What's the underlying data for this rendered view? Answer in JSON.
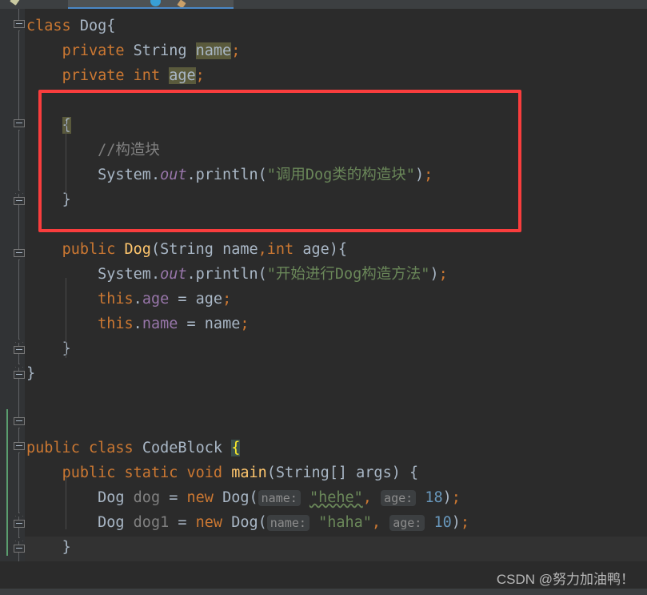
{
  "app": {
    "theme": "darcula",
    "editor_background": "#2b2b2b",
    "gutter_background": "#313335",
    "accent_tab_underline": "#4a88c7",
    "annotation_color": "#f93d3d"
  },
  "tabbar": {
    "active_tab_icon": "java-class-icon",
    "left_tab_icon": "file-icon",
    "right_tab_icon": "file-icon"
  },
  "annotation": {
    "label": "red-highlight-rectangle",
    "target": "instance-initializer-block"
  },
  "gutter": {
    "fold_markers": [
      {
        "name": "fold-class-dog",
        "state": "expanded-start"
      },
      {
        "name": "fold-init-block",
        "state": "expanded-start"
      },
      {
        "name": "fold-init-block-end",
        "state": "expanded-end"
      },
      {
        "name": "fold-constructor",
        "state": "expanded-start"
      },
      {
        "name": "fold-constructor-end",
        "state": "expanded-end"
      },
      {
        "name": "fold-class-dog-end",
        "state": "expanded-end"
      },
      {
        "name": "fold-class-codeblock",
        "state": "expanded-start"
      },
      {
        "name": "fold-main-method",
        "state": "expanded-start"
      },
      {
        "name": "fold-main-method-end",
        "state": "expanded-end"
      },
      {
        "name": "fold-class-codeblock-end",
        "state": "expanded-end"
      }
    ],
    "change_marker_color": "#5a9e6f"
  },
  "code": {
    "language": "java",
    "lines": [
      {
        "n": 1,
        "tokens": [
          {
            "t": "class",
            "c": "kw"
          },
          {
            "t": " ",
            "c": "plain"
          },
          {
            "t": "Dog",
            "c": "cls"
          },
          {
            "t": "{",
            "c": "punc"
          }
        ]
      },
      {
        "n": 2,
        "tokens": [
          {
            "t": "    ",
            "c": "plain"
          },
          {
            "t": "private",
            "c": "kw"
          },
          {
            "t": " ",
            "c": "plain"
          },
          {
            "t": "String",
            "c": "type"
          },
          {
            "t": " ",
            "c": "plain"
          },
          {
            "t": "name",
            "c": "ident-hl"
          },
          {
            "t": ";",
            "c": "semi"
          }
        ]
      },
      {
        "n": 3,
        "tokens": [
          {
            "t": "    ",
            "c": "plain"
          },
          {
            "t": "private",
            "c": "kw"
          },
          {
            "t": " ",
            "c": "plain"
          },
          {
            "t": "int",
            "c": "kw"
          },
          {
            "t": " ",
            "c": "plain"
          },
          {
            "t": "age",
            "c": "ident-hl"
          },
          {
            "t": ";",
            "c": "semi"
          }
        ]
      },
      {
        "n": 4,
        "tokens": []
      },
      {
        "n": 5,
        "tokens": [
          {
            "t": "    ",
            "c": "plain"
          },
          {
            "t": "{",
            "c": "ident-hl"
          }
        ]
      },
      {
        "n": 6,
        "tokens": [
          {
            "t": "        ",
            "c": "plain"
          },
          {
            "t": "//构造块",
            "c": "cmt"
          }
        ]
      },
      {
        "n": 7,
        "tokens": [
          {
            "t": "        ",
            "c": "plain"
          },
          {
            "t": "System",
            "c": "cls"
          },
          {
            "t": ".",
            "c": "punc"
          },
          {
            "t": "out",
            "c": "static"
          },
          {
            "t": ".",
            "c": "punc"
          },
          {
            "t": "println",
            "c": "plain"
          },
          {
            "t": "(",
            "c": "punc"
          },
          {
            "t": "\"调用Dog类的构造块\"",
            "c": "str"
          },
          {
            "t": ")",
            "c": "punc"
          },
          {
            "t": ";",
            "c": "semi"
          }
        ]
      },
      {
        "n": 8,
        "tokens": [
          {
            "t": "    ",
            "c": "plain"
          },
          {
            "t": "}",
            "c": "punc"
          }
        ]
      },
      {
        "n": 9,
        "tokens": []
      },
      {
        "n": 10,
        "tokens": [
          {
            "t": "    ",
            "c": "plain"
          },
          {
            "t": "public",
            "c": "kw"
          },
          {
            "t": " ",
            "c": "plain"
          },
          {
            "t": "Dog",
            "c": "method"
          },
          {
            "t": "(",
            "c": "punc"
          },
          {
            "t": "String",
            "c": "type"
          },
          {
            "t": " ",
            "c": "plain"
          },
          {
            "t": "name",
            "c": "local"
          },
          {
            "t": ",",
            "c": "semi"
          },
          {
            "t": "int",
            "c": "kw"
          },
          {
            "t": " ",
            "c": "plain"
          },
          {
            "t": "age",
            "c": "local"
          },
          {
            "t": ")",
            "c": "punc"
          },
          {
            "t": "{",
            "c": "punc"
          }
        ]
      },
      {
        "n": 11,
        "tokens": [
          {
            "t": "        ",
            "c": "plain"
          },
          {
            "t": "System",
            "c": "cls"
          },
          {
            "t": ".",
            "c": "punc"
          },
          {
            "t": "out",
            "c": "static"
          },
          {
            "t": ".",
            "c": "punc"
          },
          {
            "t": "println",
            "c": "plain"
          },
          {
            "t": "(",
            "c": "punc"
          },
          {
            "t": "\"开始进行Dog构造方法\"",
            "c": "str"
          },
          {
            "t": ")",
            "c": "punc"
          },
          {
            "t": ";",
            "c": "semi"
          }
        ]
      },
      {
        "n": 12,
        "tokens": [
          {
            "t": "        ",
            "c": "plain"
          },
          {
            "t": "this",
            "c": "kw"
          },
          {
            "t": ".",
            "c": "punc"
          },
          {
            "t": "age",
            "c": "field"
          },
          {
            "t": " = ",
            "c": "plain"
          },
          {
            "t": "age",
            "c": "local"
          },
          {
            "t": ";",
            "c": "semi"
          }
        ]
      },
      {
        "n": 13,
        "tokens": [
          {
            "t": "        ",
            "c": "plain"
          },
          {
            "t": "this",
            "c": "kw"
          },
          {
            "t": ".",
            "c": "punc"
          },
          {
            "t": "name",
            "c": "field"
          },
          {
            "t": " = ",
            "c": "plain"
          },
          {
            "t": "name",
            "c": "local"
          },
          {
            "t": ";",
            "c": "semi"
          }
        ]
      },
      {
        "n": 14,
        "tokens": [
          {
            "t": "    ",
            "c": "plain"
          },
          {
            "t": "}",
            "c": "punc"
          }
        ]
      },
      {
        "n": 15,
        "tokens": [
          {
            "t": "}",
            "c": "punc"
          }
        ]
      },
      {
        "n": 16,
        "tokens": []
      },
      {
        "n": 17,
        "tokens": []
      },
      {
        "n": 18,
        "tokens": [
          {
            "t": "public",
            "c": "kw"
          },
          {
            "t": " ",
            "c": "plain"
          },
          {
            "t": "class",
            "c": "kw"
          },
          {
            "t": " ",
            "c": "plain"
          },
          {
            "t": "CodeBlock",
            "c": "cls"
          },
          {
            "t": " ",
            "c": "plain"
          },
          {
            "t": "{",
            "c": "brace-hl"
          }
        ]
      },
      {
        "n": 19,
        "tokens": [
          {
            "t": "    ",
            "c": "plain"
          },
          {
            "t": "public",
            "c": "kw"
          },
          {
            "t": " ",
            "c": "plain"
          },
          {
            "t": "static",
            "c": "kw"
          },
          {
            "t": " ",
            "c": "plain"
          },
          {
            "t": "void",
            "c": "kw"
          },
          {
            "t": " ",
            "c": "plain"
          },
          {
            "t": "main",
            "c": "method"
          },
          {
            "t": "(",
            "c": "punc"
          },
          {
            "t": "String",
            "c": "type"
          },
          {
            "t": "[] ",
            "c": "punc"
          },
          {
            "t": "args",
            "c": "local"
          },
          {
            "t": ") ",
            "c": "punc"
          },
          {
            "t": "{",
            "c": "punc"
          }
        ]
      },
      {
        "n": 20,
        "tokens": [
          {
            "t": "        ",
            "c": "plain"
          },
          {
            "t": "Dog",
            "c": "cls"
          },
          {
            "t": " ",
            "c": "plain"
          },
          {
            "t": "dog",
            "c": "cmt"
          },
          {
            "t": " = ",
            "c": "plain"
          },
          {
            "t": "new",
            "c": "kw"
          },
          {
            "t": " ",
            "c": "plain"
          },
          {
            "t": "Dog",
            "c": "cls"
          },
          {
            "t": "(",
            "c": "punc"
          },
          {
            "t": "name:",
            "c": "hint"
          },
          {
            "t": " ",
            "c": "plain"
          },
          {
            "t": "\"hehe\"",
            "c": "str typo"
          },
          {
            "t": ",",
            "c": "semi"
          },
          {
            "t": " ",
            "c": "plain"
          },
          {
            "t": "age:",
            "c": "hint"
          },
          {
            "t": " ",
            "c": "plain"
          },
          {
            "t": "18",
            "c": "num"
          },
          {
            "t": ")",
            "c": "punc"
          },
          {
            "t": ";",
            "c": "semi"
          }
        ]
      },
      {
        "n": 21,
        "tokens": [
          {
            "t": "        ",
            "c": "plain"
          },
          {
            "t": "Dog",
            "c": "cls"
          },
          {
            "t": " ",
            "c": "plain"
          },
          {
            "t": "dog1",
            "c": "cmt"
          },
          {
            "t": " = ",
            "c": "plain"
          },
          {
            "t": "new",
            "c": "kw"
          },
          {
            "t": " ",
            "c": "plain"
          },
          {
            "t": "Dog",
            "c": "cls"
          },
          {
            "t": "(",
            "c": "punc"
          },
          {
            "t": "name:",
            "c": "hint"
          },
          {
            "t": " ",
            "c": "plain"
          },
          {
            "t": "\"haha\"",
            "c": "str"
          },
          {
            "t": ",",
            "c": "semi"
          },
          {
            "t": " ",
            "c": "plain"
          },
          {
            "t": "age:",
            "c": "hint"
          },
          {
            "t": " ",
            "c": "plain"
          },
          {
            "t": "10",
            "c": "num"
          },
          {
            "t": ")",
            "c": "punc"
          },
          {
            "t": ";",
            "c": "semi"
          }
        ]
      },
      {
        "n": 22,
        "tokens": [
          {
            "t": "    ",
            "c": "plain"
          },
          {
            "t": "}",
            "c": "punc"
          }
        ]
      },
      {
        "n": 23,
        "tokens": [
          {
            "t": "}",
            "c": "brace-hl"
          }
        ]
      }
    ]
  },
  "watermark": {
    "text": "CSDN @努力加油鸭！"
  }
}
